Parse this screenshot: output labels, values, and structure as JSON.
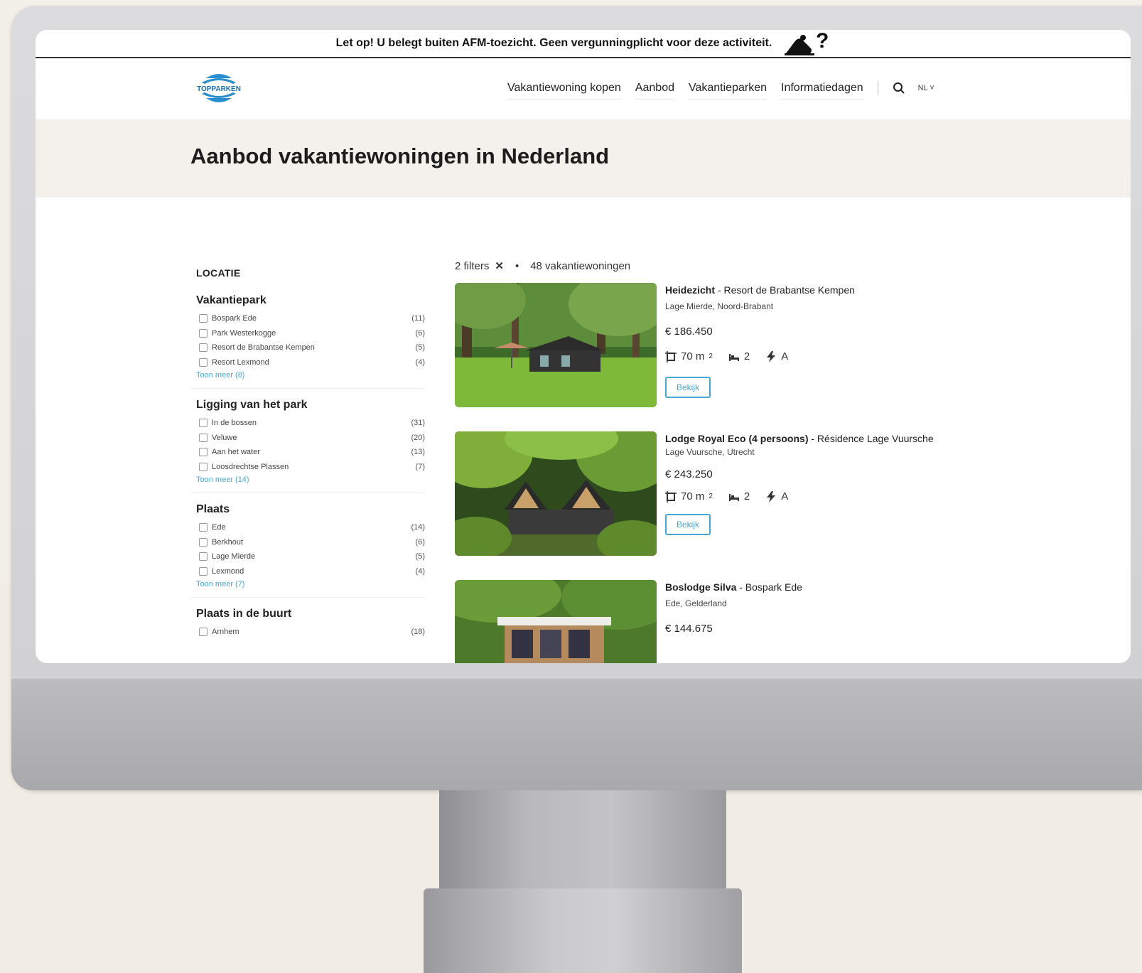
{
  "afm_notice": "Let op! U belegt buiten AFM-toezicht. Geen vergunningplicht voor deze activiteit.",
  "logo_text": "TOPPARKEN",
  "nav": {
    "links": [
      "Vakantiewoning kopen",
      "Aanbod",
      "Vakantieparken",
      "Informatiedagen"
    ],
    "lang": "NL"
  },
  "page_title": "Aanbod vakantiewoningen in Nederland",
  "sidebar": {
    "heading": "LOCATIE",
    "groups": [
      {
        "title": "Vakantiepark",
        "items": [
          {
            "label": "Bospark Ede",
            "count": "(11)"
          },
          {
            "label": "Park Westerkogge",
            "count": "(6)"
          },
          {
            "label": "Resort de Brabantse Kempen",
            "count": "(5)"
          },
          {
            "label": "Resort Lexmond",
            "count": "(4)"
          }
        ],
        "more": "Toon meer (8)"
      },
      {
        "title": "Ligging van het park",
        "items": [
          {
            "label": "In de bossen",
            "count": "(31)"
          },
          {
            "label": "Veluwe",
            "count": "(20)"
          },
          {
            "label": "Aan het water",
            "count": "(13)"
          },
          {
            "label": "Loosdrechtse Plassen",
            "count": "(7)"
          }
        ],
        "more": "Toon meer (14)"
      },
      {
        "title": "Plaats",
        "items": [
          {
            "label": "Ede",
            "count": "(14)"
          },
          {
            "label": "Berkhout",
            "count": "(6)"
          },
          {
            "label": "Lage Mierde",
            "count": "(5)"
          },
          {
            "label": "Lexmond",
            "count": "(4)"
          }
        ],
        "more": "Toon meer (7)"
      },
      {
        "title": "Plaats in de buurt",
        "items": [
          {
            "label": "Arnhem",
            "count": "(18)"
          }
        ],
        "more": ""
      }
    ]
  },
  "results": {
    "filters": "2 filters",
    "separator": "•",
    "count": "48 vakantiewoningen",
    "cards": [
      {
        "name": "Heidezicht",
        "park": " - Resort de Brabantse Kempen",
        "location": "Lage Mierde, Noord-Brabant",
        "price": "€ 186.450",
        "area": "70 m",
        "beds": "2",
        "energy": "A",
        "button": "Bekijk"
      },
      {
        "name": "Lodge Royal Eco (4 persoons)",
        "park": " - Résidence Lage Vuursche",
        "location": "Lage Vuursche, Utrecht",
        "price": "€ 243.250",
        "area": "70 m",
        "beds": "2",
        "energy": "A",
        "button": "Bekijk"
      },
      {
        "name": "Boslodge Silva",
        "park": " - Bospark Ede",
        "location": "Ede, Gelderland",
        "price": "€ 144.675"
      }
    ]
  },
  "colors": {
    "accent": "#49a7d8",
    "logo_blue": "#2a8fd0",
    "hero_bg": "#f4f1ec"
  }
}
